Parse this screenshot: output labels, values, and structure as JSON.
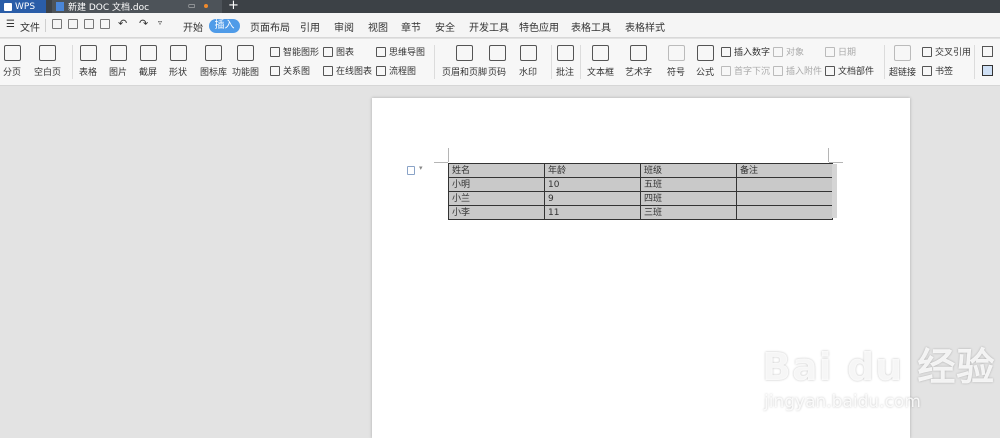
{
  "titlebar": {
    "app_name": "WPS",
    "doc_tab": "新建 DOC 文档.doc",
    "new_tab": "+"
  },
  "menubar": {
    "file": "文件",
    "tabs": [
      "开始",
      "插入",
      "页面布局",
      "引用",
      "审阅",
      "视图",
      "章节",
      "安全",
      "开发工具",
      "特色应用",
      "表格工具",
      "表格样式"
    ],
    "active_tab": "插入"
  },
  "ribbon": {
    "page_break": "分页",
    "blank_page": "空白页",
    "table": "表格",
    "picture": "图片",
    "screenshot": "截屏",
    "shape": "形状",
    "icon_library": "图标库",
    "function_chart": "功能图",
    "smart_shape": "智能图形",
    "chart": "图表",
    "mind_map": "思维导图",
    "relation_chart": "关系图",
    "online_chart": "在线图表",
    "flowchart": "流程图",
    "header_footer": "页眉和页脚",
    "page_number": "页码",
    "watermark": "水印",
    "comment": "批注",
    "text_box": "文本框",
    "word_art": "艺术字",
    "symbol": "符号",
    "formula": "公式",
    "insert_number": "插入数字",
    "first_drop": "首字下沉",
    "object": "对象",
    "insert_attachment": "插入附件",
    "date": "日期",
    "doc_parts": "文档部件",
    "hyperlink": "超链接",
    "cross_reference": "交叉引用",
    "bookmark": "书签"
  },
  "doc_table": {
    "rows": [
      [
        "姓名",
        "年龄",
        "班级",
        "备注"
      ],
      [
        "小明",
        "10",
        "五班",
        ""
      ],
      [
        "小兰",
        "9",
        "四班",
        ""
      ],
      [
        "小李",
        "11",
        "三班",
        ""
      ]
    ]
  },
  "watermark": {
    "brand": "Bai du 经验",
    "site": "jingyan.baidu.com"
  },
  "colors": {
    "accent": "#4f9be8",
    "titlebar": "#3c4146",
    "table_fill": "#c9c9c9"
  }
}
